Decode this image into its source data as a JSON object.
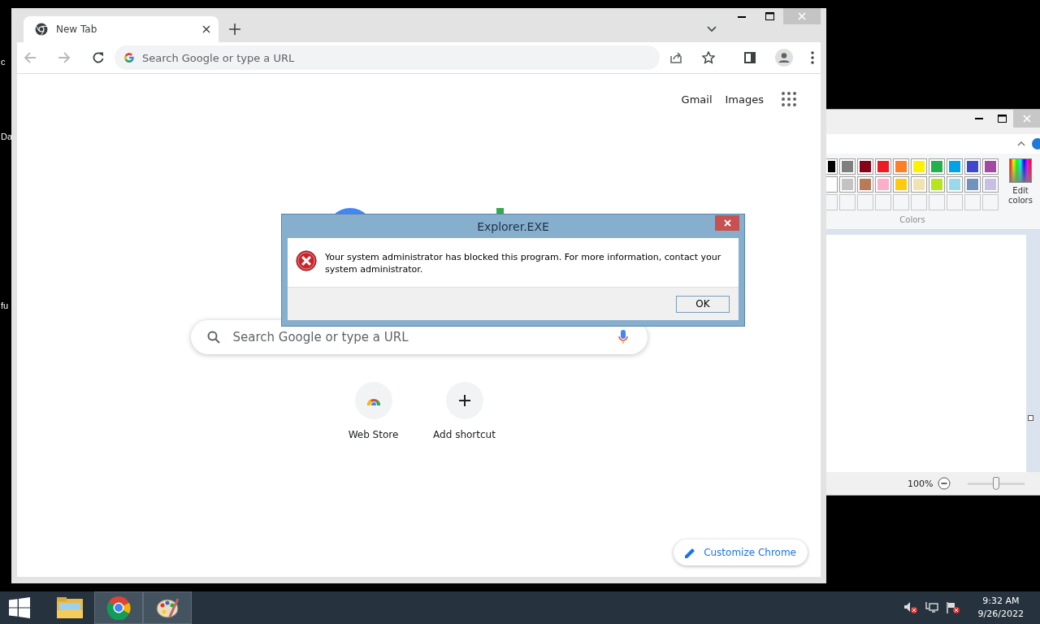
{
  "desktop": {
    "icon_labels": [
      "c",
      "Da",
      "fu"
    ]
  },
  "browser": {
    "tabs": [
      {
        "title": "New Tab",
        "selected": true
      }
    ],
    "nav": {
      "back_disabled": true,
      "forward_disabled": true
    },
    "address_bar": {
      "placeholder": "Search Google or type a URL"
    },
    "header_links": [
      "Gmail",
      "Images"
    ],
    "search": {
      "placeholder": "Search Google or type a URL"
    },
    "shortcuts": [
      {
        "label": "Web Store",
        "kind": "webstore"
      },
      {
        "label": "Add shortcut",
        "kind": "add"
      }
    ],
    "customize_button": "Customize Chrome"
  },
  "paint": {
    "palette_rows": [
      {
        "swatches": [
          {
            "color": "#000000"
          },
          {
            "color": "#7f7f7f"
          },
          {
            "color": "#880015"
          },
          {
            "color": "#ed1c24"
          },
          {
            "color": "#ff7f27"
          },
          {
            "color": "#fff200"
          },
          {
            "color": "#22b14c"
          },
          {
            "color": "#00a2e8"
          },
          {
            "color": "#3f48cc"
          },
          {
            "color": "#a349a4"
          }
        ]
      },
      {
        "swatches": [
          {
            "color": "#ffffff"
          },
          {
            "color": "#c3c3c3"
          },
          {
            "color": "#b97a57"
          },
          {
            "color": "#ffaec9"
          },
          {
            "color": "#ffc90e"
          },
          {
            "color": "#efe4b0"
          },
          {
            "color": "#b5e61d"
          },
          {
            "color": "#99d9ea"
          },
          {
            "color": "#7092be"
          },
          {
            "color": "#c8bfe7"
          }
        ]
      }
    ],
    "edit_colors": "Edit colors",
    "group_label": "Colors",
    "zoom": {
      "reading": "100%",
      "level": 0.5
    }
  },
  "dialog": {
    "title": "Explorer.EXE",
    "message": "Your system administrator has blocked this program. For more information, contact your system administrator.",
    "buttons": [
      "OK"
    ]
  },
  "taskbar": {
    "apps": [
      {
        "kind": "explorer",
        "active": false
      },
      {
        "kind": "chrome",
        "active": true
      },
      {
        "kind": "paint",
        "active": true
      }
    ],
    "clock": {
      "time": "9:32 AM",
      "date": "9/26/2022"
    }
  }
}
